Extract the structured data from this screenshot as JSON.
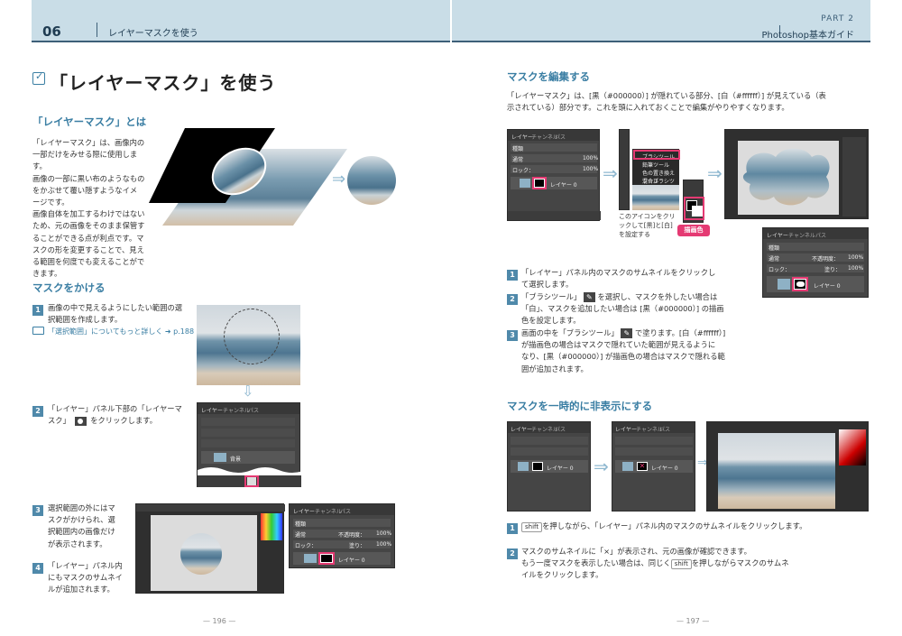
{
  "header": {
    "chapter_num": "06",
    "chapter_title": "レイヤーマスクを使う",
    "part_label": "PART 2",
    "guide_label": "Photoshop基本ガイド"
  },
  "left": {
    "title": "「レイヤーマスク」を使う",
    "section1": {
      "heading": "「レイヤーマスク」とは",
      "paragraph": [
        "「レイヤーマスク」は、画像内の",
        "一部だけをみせる際に使用します。",
        "画像の一部に黒い布のようなもの",
        "をかぶせて覆い隠すようなイメ",
        "ージです。",
        "画像自体を加工するわけではない",
        "ため、元の画像をそのまま保管す",
        "ることができる点が利点です。マ",
        "スクの形を変更することで、見え",
        "る範囲を何度でも変えることがで",
        "きます。"
      ]
    },
    "section2": {
      "heading": "マスクをかける",
      "steps": [
        {
          "num": "1",
          "lines": [
            "画像の中で見えるようにしたい範囲の選",
            "択範囲を作成します。"
          ]
        },
        {
          "num": "2",
          "lines": [
            "「レイヤー」パネル下部の「レイヤーマ",
            "スク」",
            "をクリックします。"
          ]
        },
        {
          "num": "3",
          "lines": [
            "選択範囲の外にはマ",
            "スクがかけられ、選",
            "択範囲内の画像だけ",
            "が表示されます。"
          ]
        },
        {
          "num": "4",
          "lines": [
            "「レイヤー」パネル内",
            "にもマスクのサムネイ",
            "ルが追加されます。"
          ]
        }
      ],
      "link_ref": "「選択範囲」についてもっと詳しく ➜ p.188"
    },
    "page_number": "— 196 —"
  },
  "right": {
    "section1": {
      "heading": "マスクを編集する",
      "intro": [
        "「レイヤーマスク」は、[黒（#000000）] が隠れている部分、[白（#ffffff）] が見えている（表",
        "示されている）部分です。これを頭に入れておくことで編集がやりやすくなります。"
      ],
      "callout": [
        "このアイコンをクリ",
        "ックして[黒]と[白]",
        "を設定する"
      ],
      "pink_label": "描画色",
      "steps": [
        {
          "num": "1",
          "lines": [
            "「レイヤー」パネル内のマスクのサムネイルをクリックし",
            "て選択します。"
          ]
        },
        {
          "num": "2",
          "lines": [
            "「ブラシツール」",
            "を選択し、マスクを外したい場合は",
            "「白」、マスクを追加したい場合は [黒（#000000）] の描画",
            "色を設定します。"
          ]
        },
        {
          "num": "3",
          "lines": [
            "画面の中を「ブラシツール」",
            "で塗ります。[白（#ffffff）]",
            "が描画色の場合はマスクで隠れていた範囲が見えるように",
            "なり、[黒（#000000）] が描画色の場合はマスクで隠れる範",
            "囲が追加されます。"
          ]
        }
      ],
      "brush_menu": [
        "ブラシツール",
        "鉛筆ツール",
        "色の置き換えツール",
        "混合ブラシツール"
      ]
    },
    "section2": {
      "heading": "マスクを一時的に非表示にする",
      "steps": [
        {
          "num": "1",
          "key": "shift",
          "text": "を押しながら、「レイヤー」パネル内のマスクのサムネイルをクリックします。"
        },
        {
          "num": "2",
          "lines": [
            "マスクのサムネイルに「×」が表示され、元の画像が確認できます。",
            "もう一度マスクを表示したい場合は、同じく",
            "を押しながらマスクのサムネ",
            "イルをクリックします。"
          ],
          "key": "shift"
        }
      ]
    },
    "page_number": "— 197 —"
  },
  "panel": {
    "tabs": [
      "レイヤー",
      "チャンネル",
      "パス"
    ],
    "kind": "種類",
    "mode": "通常",
    "opacity_label": "不透明度：",
    "opacity": "100%",
    "lock_label": "ロック：",
    "fill_label": "塗り：",
    "fill": "100%",
    "layer_name": "レイヤー 0",
    "bg_name": "背景"
  },
  "colors": {
    "accent": "#3a7ea3",
    "pink": "#e53a73",
    "header_band": "#c9dde7",
    "step_box": "#4f89aa"
  }
}
